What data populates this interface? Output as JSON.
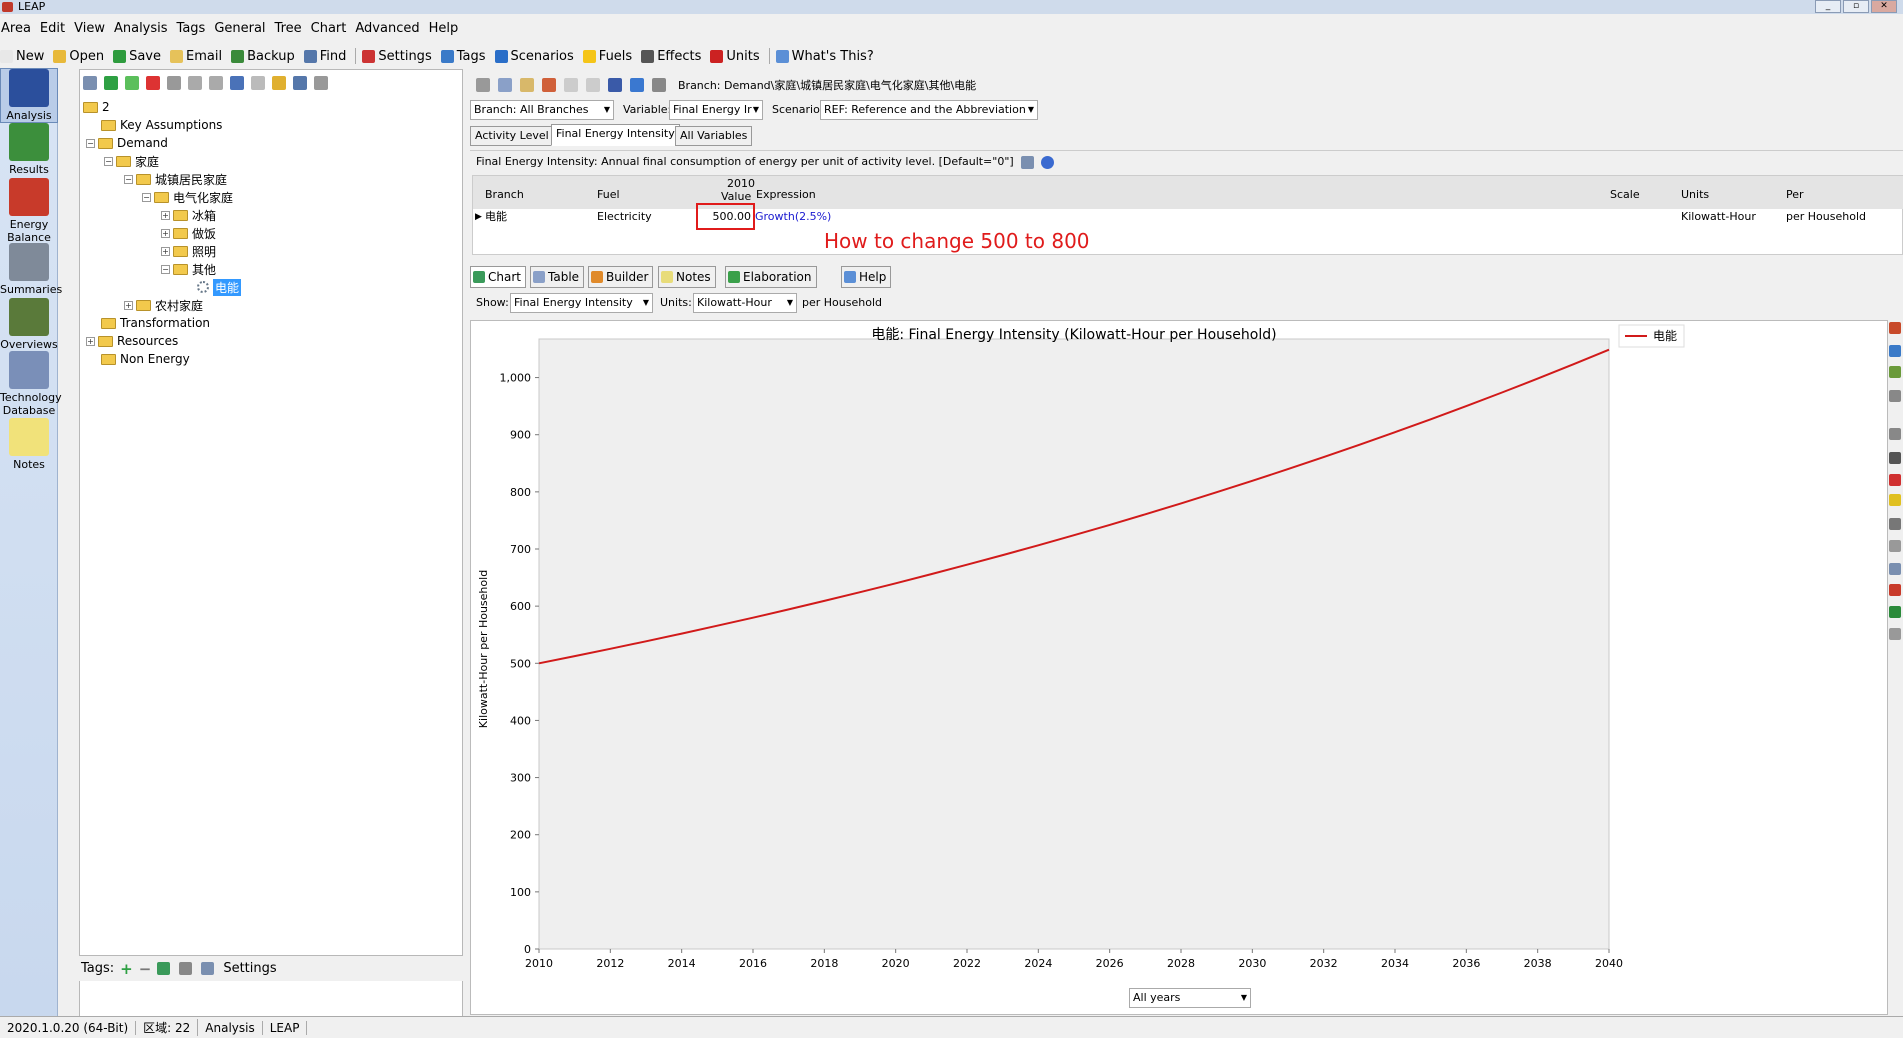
{
  "window": {
    "title": "LEAP",
    "min": "_",
    "max": "▫",
    "close": "✕"
  },
  "menu": [
    "Area",
    "Edit",
    "View",
    "Analysis",
    "Tags",
    "General",
    "Tree",
    "Chart",
    "Advanced",
    "Help"
  ],
  "toolbar": [
    {
      "label": "New",
      "icon": "new-icon",
      "color": "#e8e8e8"
    },
    {
      "label": "Open",
      "icon": "open-icon",
      "color": "#e8b93a"
    },
    {
      "label": "Save",
      "icon": "save-icon",
      "color": "#2e9b3e"
    },
    {
      "label": "Email",
      "icon": "email-icon",
      "color": "#e6c25a"
    },
    {
      "label": "Backup",
      "icon": "backup-icon",
      "color": "#3a8a3a"
    },
    {
      "label": "Find",
      "icon": "find-icon",
      "color": "#5577aa"
    },
    {
      "label": "Settings",
      "icon": "settings-icon",
      "color": "#cc3333"
    },
    {
      "label": "Tags",
      "icon": "tag-icon",
      "color": "#3a7ac8"
    },
    {
      "label": "Scenarios",
      "icon": "scenarios-icon",
      "color": "#2a6ec8"
    },
    {
      "label": "Fuels",
      "icon": "fuels-icon",
      "color": "#f5c518"
    },
    {
      "label": "Effects",
      "icon": "effects-icon",
      "color": "#555"
    },
    {
      "label": "Units",
      "icon": "units-icon",
      "color": "#cc2222"
    },
    {
      "label": "What's This?",
      "icon": "help-icon",
      "color": "#5b8fd6"
    }
  ],
  "sidebar": [
    {
      "label": "Analysis",
      "icon": "analysis-icon",
      "color": "#2b4f9c"
    },
    {
      "label": "Results",
      "icon": "results-icon",
      "color": "#3c8f3c"
    },
    {
      "label": "Energy Balance",
      "icon": "energy-balance-icon",
      "color": "#c83a2a"
    },
    {
      "label": "Summaries",
      "icon": "summaries-icon",
      "color": "#7f8a99"
    },
    {
      "label": "Overviews",
      "icon": "overviews-icon",
      "color": "#5a7a3a"
    },
    {
      "label": "Technology Database",
      "icon": "technology-database-icon",
      "color": "#7a8fb8"
    },
    {
      "label": "Notes",
      "icon": "notes-icon",
      "color": "#f1e27a"
    }
  ],
  "tree": {
    "root": "2",
    "items": [
      "Key Assumptions",
      "Demand",
      "家庭",
      "城镇居民家庭",
      "电气化家庭",
      "冰箱",
      "做饭",
      "照明",
      "其他",
      "电能",
      "农村家庭",
      "Transformation",
      "Resources",
      "Non Energy"
    ]
  },
  "tags_bar": {
    "label": "Tags:",
    "settings": "Settings"
  },
  "status": [
    "2020.1.0.20 (64-Bit)",
    "区域: 22",
    "Analysis",
    "LEAP"
  ],
  "breadcrumb": "Branch: Demand\\家庭\\城镇居民家庭\\电气化家庭\\其他\\电能",
  "selectors": {
    "branch": "Branch: All Branches",
    "variable_label": "Variable:",
    "variable": "Final Energy Ir",
    "scenario_label": "Scenario:",
    "scenario": "REF: Reference and the Abbreviation"
  },
  "tabs": [
    "Activity Level",
    "Final Energy Intensity",
    "All Variables"
  ],
  "description": "Final Energy Intensity: Annual final consumption of energy per unit of activity level. [Default=\"0\"]",
  "grid": {
    "headers": {
      "branch": "Branch",
      "fuel": "Fuel",
      "value_year": "2010",
      "value": "Value",
      "expression": "Expression",
      "scale": "Scale",
      "units": "Units",
      "per": "Per"
    },
    "row": {
      "branch": "电能",
      "fuel": "Electricity",
      "value": "500.00",
      "expression": "Growth(2.5%)",
      "scale": "",
      "units": "Kilowatt-Hour",
      "per": "per Household"
    }
  },
  "annotation": "How to change 500 to 800",
  "bottom_tabs": [
    {
      "label": "Chart",
      "icon": "chart-icon",
      "color": "#3a9a5a"
    },
    {
      "label": "Table",
      "icon": "table-icon",
      "color": "#8aa0c8"
    },
    {
      "label": "Builder",
      "icon": "builder-icon",
      "color": "#e08a2a"
    },
    {
      "label": "Notes",
      "icon": "notes-icon",
      "color": "#e8dc7a"
    },
    {
      "label": "Elaboration",
      "icon": "elaboration-icon",
      "color": "#3aa04a"
    },
    {
      "label": "Help",
      "icon": "help-icon",
      "color": "#5b8fd6"
    }
  ],
  "chart_controls": {
    "show_label": "Show:",
    "show": "Final Energy Intensity",
    "units_label": "Units:",
    "units": "Kilowatt-Hour",
    "per": "per Household",
    "years": "All years"
  },
  "chart_data": {
    "type": "line",
    "title": "电能: Final Energy Intensity (Kilowatt-Hour per Household)",
    "xlabel": "",
    "ylabel": "Kilowatt-Hour per Household",
    "ylim": [
      0,
      1050
    ],
    "yticks": [
      "0",
      "100",
      "200",
      "300",
      "400",
      "500",
      "600",
      "700",
      "800",
      "900",
      "1,000"
    ],
    "xticks": [
      "2010",
      "2012",
      "2014",
      "2016",
      "2018",
      "2020",
      "2022",
      "2024",
      "2026",
      "2028",
      "2030",
      "2032",
      "2034",
      "2036",
      "2038",
      "2040"
    ],
    "legend_position": "top-right",
    "grid": false,
    "series": [
      {
        "name": "电能",
        "color": "#d11a1a",
        "x": [
          2010,
          2040
        ],
        "start_value": 500.0,
        "growth_rate": 0.025
      }
    ]
  }
}
